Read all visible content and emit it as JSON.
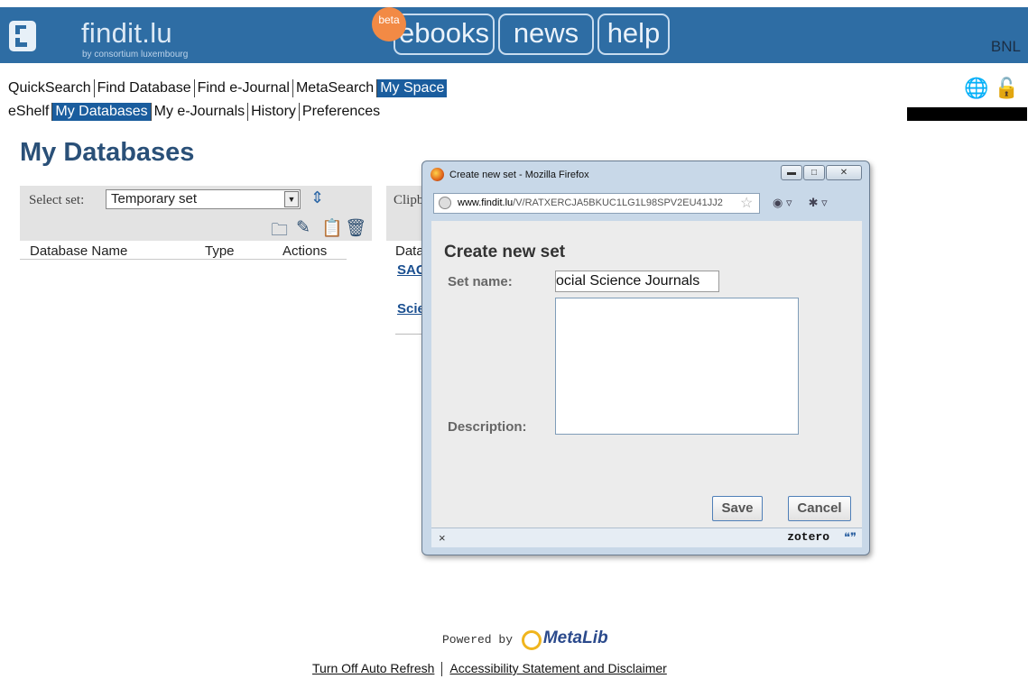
{
  "header": {
    "brand": "findit.lu",
    "brand_sub": "by consortium luxembourg",
    "beta_badge": "beta",
    "tabs": [
      "ebooks",
      "news",
      "help"
    ],
    "institution": "BNL",
    "colors": {
      "bar": "#2e6da4",
      "active": "#1a5d9e"
    }
  },
  "nav": {
    "primary": [
      "QuickSearch",
      "Find Database",
      "Find e-Journal",
      "MetaSearch",
      "My Space"
    ],
    "primary_active": "My Space",
    "secondary": [
      "eShelf",
      "My Databases",
      "My e-Journals",
      "History",
      "Preferences"
    ],
    "secondary_active": "My Databases",
    "icons": [
      "globe-icon",
      "unlock-icon"
    ]
  },
  "page": {
    "title": "My Databases"
  },
  "left_panel": {
    "select_label": "Select set:",
    "select_value": "Temporary set",
    "tool_icons": [
      "new-set-icon",
      "edit-set-icon",
      "copy-set-icon",
      "delete-set-icon"
    ],
    "columns": [
      "Database Name",
      "Type",
      "Actions"
    ]
  },
  "clipboard_panel": {
    "label": "Clipb",
    "column": "Data",
    "links": [
      "SAG",
      "Scie"
    ]
  },
  "popup": {
    "title": "Create new set - Mozilla Firefox",
    "url_domain": "www.findit.lu",
    "url_path": "/V/RATXERCJA5BKUC1LG1L98SPV2EU41JJ2",
    "heading": "Create new set",
    "set_name_label": "Set name:",
    "set_name_value": "ocial Science Journals",
    "description_label": "Description:",
    "save_label": "Save",
    "cancel_label": "Cancel",
    "status_close": "×",
    "status_addon": "zotero"
  },
  "footer": {
    "powered_by": "Powered by",
    "metalib": "MetaLib",
    "links": [
      "Turn Off Auto Refresh",
      "Accessibility Statement and Disclaimer"
    ]
  }
}
